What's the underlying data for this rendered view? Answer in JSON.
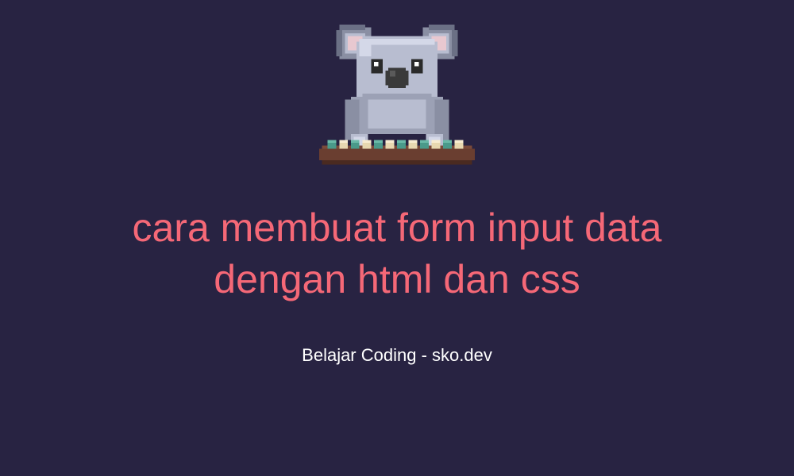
{
  "title": "cara membuat form input data dengan html dan css",
  "subtitle": "Belajar Coding - sko.dev",
  "icon_name": "koala-coding"
}
